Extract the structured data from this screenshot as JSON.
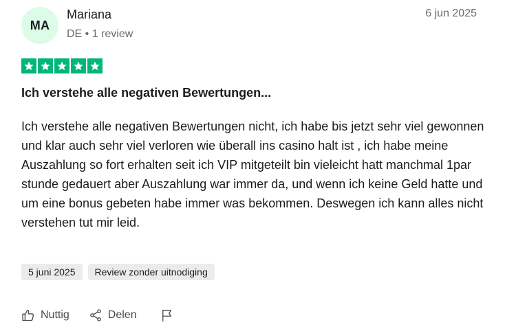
{
  "reviewer": {
    "initials": "MA",
    "name": "Mariana",
    "meta": "DE • 1 review"
  },
  "review": {
    "date": "6 jun 2025",
    "rating": 5,
    "title": "Ich verstehe alle negativen Bewertungen...",
    "body": "Ich verstehe alle negativen Bewertungen nicht, ich habe bis jetzt sehr viel gewonnen und klar auch sehr viel verloren wie überall ins casino halt ist , ich habe meine Auszahlung so fort erhalten seit ich VIP mitgeteilt bin vieleicht hatt manchmal 1par stunde gedauert aber Auszahlung war immer da, und wenn ich keine Geld hatte und um eine bonus gebeten habe immer was bekommen. Deswegen ich kann alles nicht verstehen tut mir leid.",
    "tags": {
      "experience_date": "5 juni 2025",
      "invitation": "Review zonder uitnodiging"
    }
  },
  "actions": {
    "useful_label": "Nuttig",
    "share_label": "Delen"
  },
  "colors": {
    "star_green": "#00b67a",
    "avatar_bg": "#dcfce7"
  },
  "icons": [
    "thumbs-up-icon",
    "share-icon",
    "flag-icon",
    "star-icon"
  ]
}
